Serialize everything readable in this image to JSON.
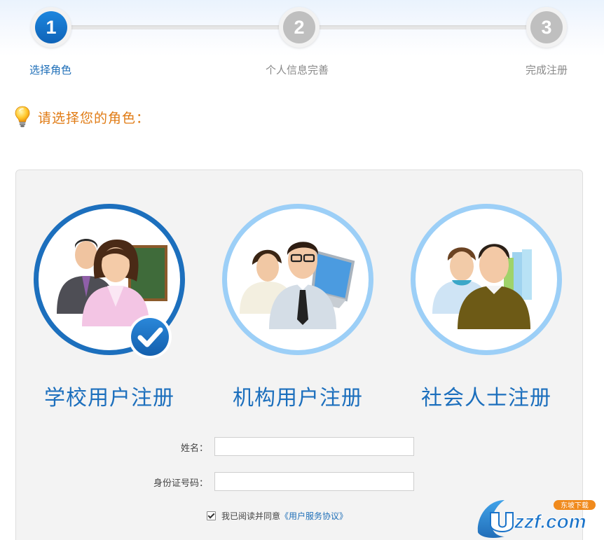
{
  "steps": [
    {
      "number": "1",
      "label": "选择角色",
      "state": "active"
    },
    {
      "number": "2",
      "label": "个人信息完善",
      "state": "todo"
    },
    {
      "number": "3",
      "label": "完成注册",
      "state": "todo"
    }
  ],
  "prompt": {
    "text": "请选择您的角色：",
    "icon": "lightbulb-icon"
  },
  "roles": [
    {
      "title": "学校用户注册",
      "selected": true,
      "icon": "teacher-avatar-icon"
    },
    {
      "title": "机构用户注册",
      "selected": false,
      "icon": "organization-avatar-icon"
    },
    {
      "title": "社会人士注册",
      "selected": false,
      "icon": "public-user-avatar-icon"
    }
  ],
  "form": {
    "name_label": "姓名：",
    "name_value": "",
    "id_label": "身份证号码：",
    "id_value": "",
    "agree_checked": true,
    "agree_text": "我已阅读并同意",
    "agree_link": "《用户服务协议》"
  },
  "watermark": {
    "text": "uzzf.com",
    "sub": "东坡下载"
  },
  "colors": {
    "primary": "#1c6fbd",
    "accent_orange": "#e07b14",
    "inactive": "#bfbfbf",
    "ring_light": "#9ccff7",
    "panel_bg": "#f3f3f3"
  }
}
